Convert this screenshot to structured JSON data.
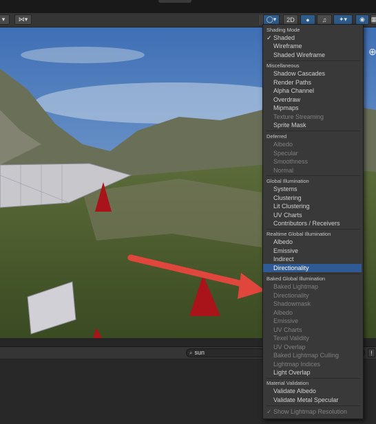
{
  "toolbar": {
    "btn_2d": "2D"
  },
  "console": {
    "search_value": "sun"
  },
  "menu": {
    "sections": [
      {
        "title": "Shading Mode",
        "items": [
          {
            "label": "Shaded",
            "checked": true
          },
          {
            "label": "Wireframe"
          },
          {
            "label": "Shaded Wireframe"
          }
        ]
      },
      {
        "title": "Miscellaneous",
        "items": [
          {
            "label": "Shadow Cascades"
          },
          {
            "label": "Render Paths"
          },
          {
            "label": "Alpha Channel"
          },
          {
            "label": "Overdraw"
          },
          {
            "label": "Mipmaps"
          },
          {
            "label": "Texture Streaming",
            "disabled": true
          },
          {
            "label": "Sprite Mask"
          }
        ]
      },
      {
        "title": "Deferred",
        "items": [
          {
            "label": "Albedo",
            "disabled": true
          },
          {
            "label": "Specular",
            "disabled": true
          },
          {
            "label": "Smoothness",
            "disabled": true
          },
          {
            "label": "Normal",
            "disabled": true
          }
        ]
      },
      {
        "title": "Global Illumination",
        "items": [
          {
            "label": "Systems"
          },
          {
            "label": "Clustering"
          },
          {
            "label": "Lit Clustering"
          },
          {
            "label": "UV Charts"
          },
          {
            "label": "Contributors / Receivers"
          }
        ]
      },
      {
        "title": "Realtime Global Illumination",
        "items": [
          {
            "label": "Albedo"
          },
          {
            "label": "Emissive"
          },
          {
            "label": "Indirect"
          },
          {
            "label": "Directionality",
            "selected": true
          }
        ]
      },
      {
        "title": "Baked Global Illumination",
        "items": [
          {
            "label": "Baked Lightmap",
            "disabled": true
          },
          {
            "label": "Directionality",
            "disabled": true
          },
          {
            "label": "Shadowmask",
            "disabled": true
          },
          {
            "label": "Albedo",
            "disabled": true
          },
          {
            "label": "Emissive",
            "disabled": true
          },
          {
            "label": "UV Charts",
            "disabled": true
          },
          {
            "label": "Texel Validity",
            "disabled": true
          },
          {
            "label": "UV Overlap",
            "disabled": true
          },
          {
            "label": "Baked Lightmap Culling",
            "disabled": true
          },
          {
            "label": "Lightmap Indices",
            "disabled": true
          },
          {
            "label": "Light Overlap"
          }
        ]
      },
      {
        "title": "Material Validation",
        "items": [
          {
            "label": "Validate Albedo"
          },
          {
            "label": "Validate Metal Specular"
          }
        ]
      }
    ],
    "footer": {
      "label": "Show Lightmap Resolution",
      "checked": true,
      "disabled": true
    }
  }
}
